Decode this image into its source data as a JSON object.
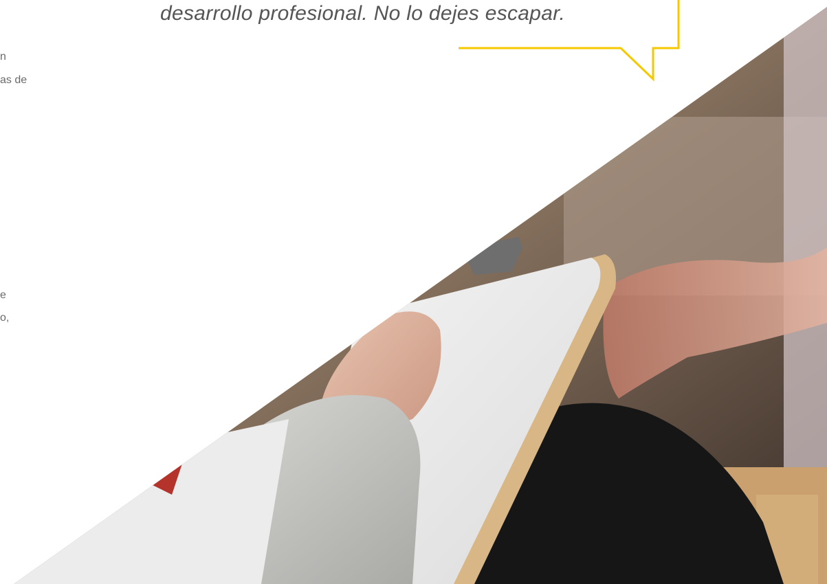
{
  "quote": {
    "text": "desarrollo profesional. No lo dejes escapar."
  },
  "side_text_top": [
    "n",
    "as de"
  ],
  "side_text_bottom": [
    "e",
    "o,"
  ],
  "photo": {
    "description_icon": "image-photo",
    "colors": {
      "accent_border": "#F5C800",
      "text": "#555555"
    }
  }
}
